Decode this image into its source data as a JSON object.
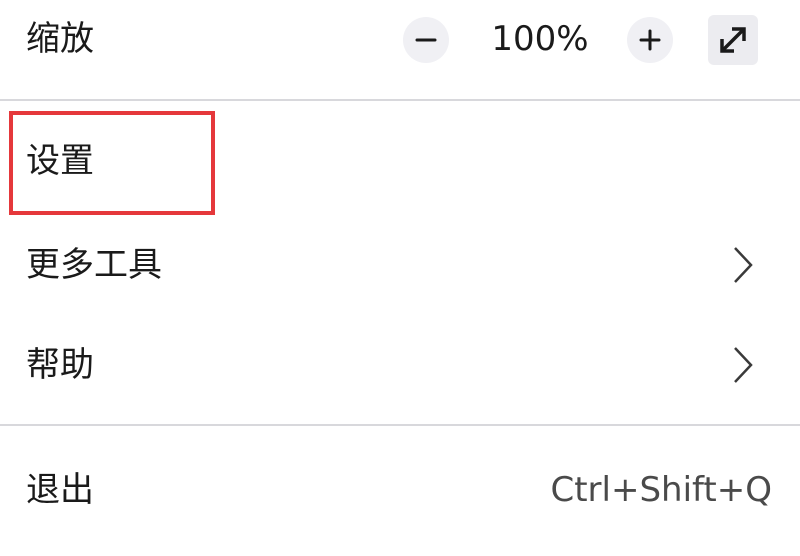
{
  "zoom": {
    "label": "缩放",
    "value": "100%",
    "zoom_out_icon": "minus-icon",
    "zoom_in_icon": "plus-icon",
    "fullscreen_icon": "expand-arrows-icon"
  },
  "items": [
    {
      "label": "设置",
      "highlighted": true
    },
    {
      "label": "更多工具",
      "submenu": true,
      "icon": "chevron-right-icon"
    },
    {
      "label": "帮助",
      "submenu": true,
      "icon": "chevron-right-icon"
    }
  ],
  "quit": {
    "label": "退出",
    "shortcut": "Ctrl+Shift+Q"
  },
  "colors": {
    "highlight_border": "#e5383b",
    "button_bg": "#f0f0f4",
    "separator": "#d8d8dc"
  }
}
